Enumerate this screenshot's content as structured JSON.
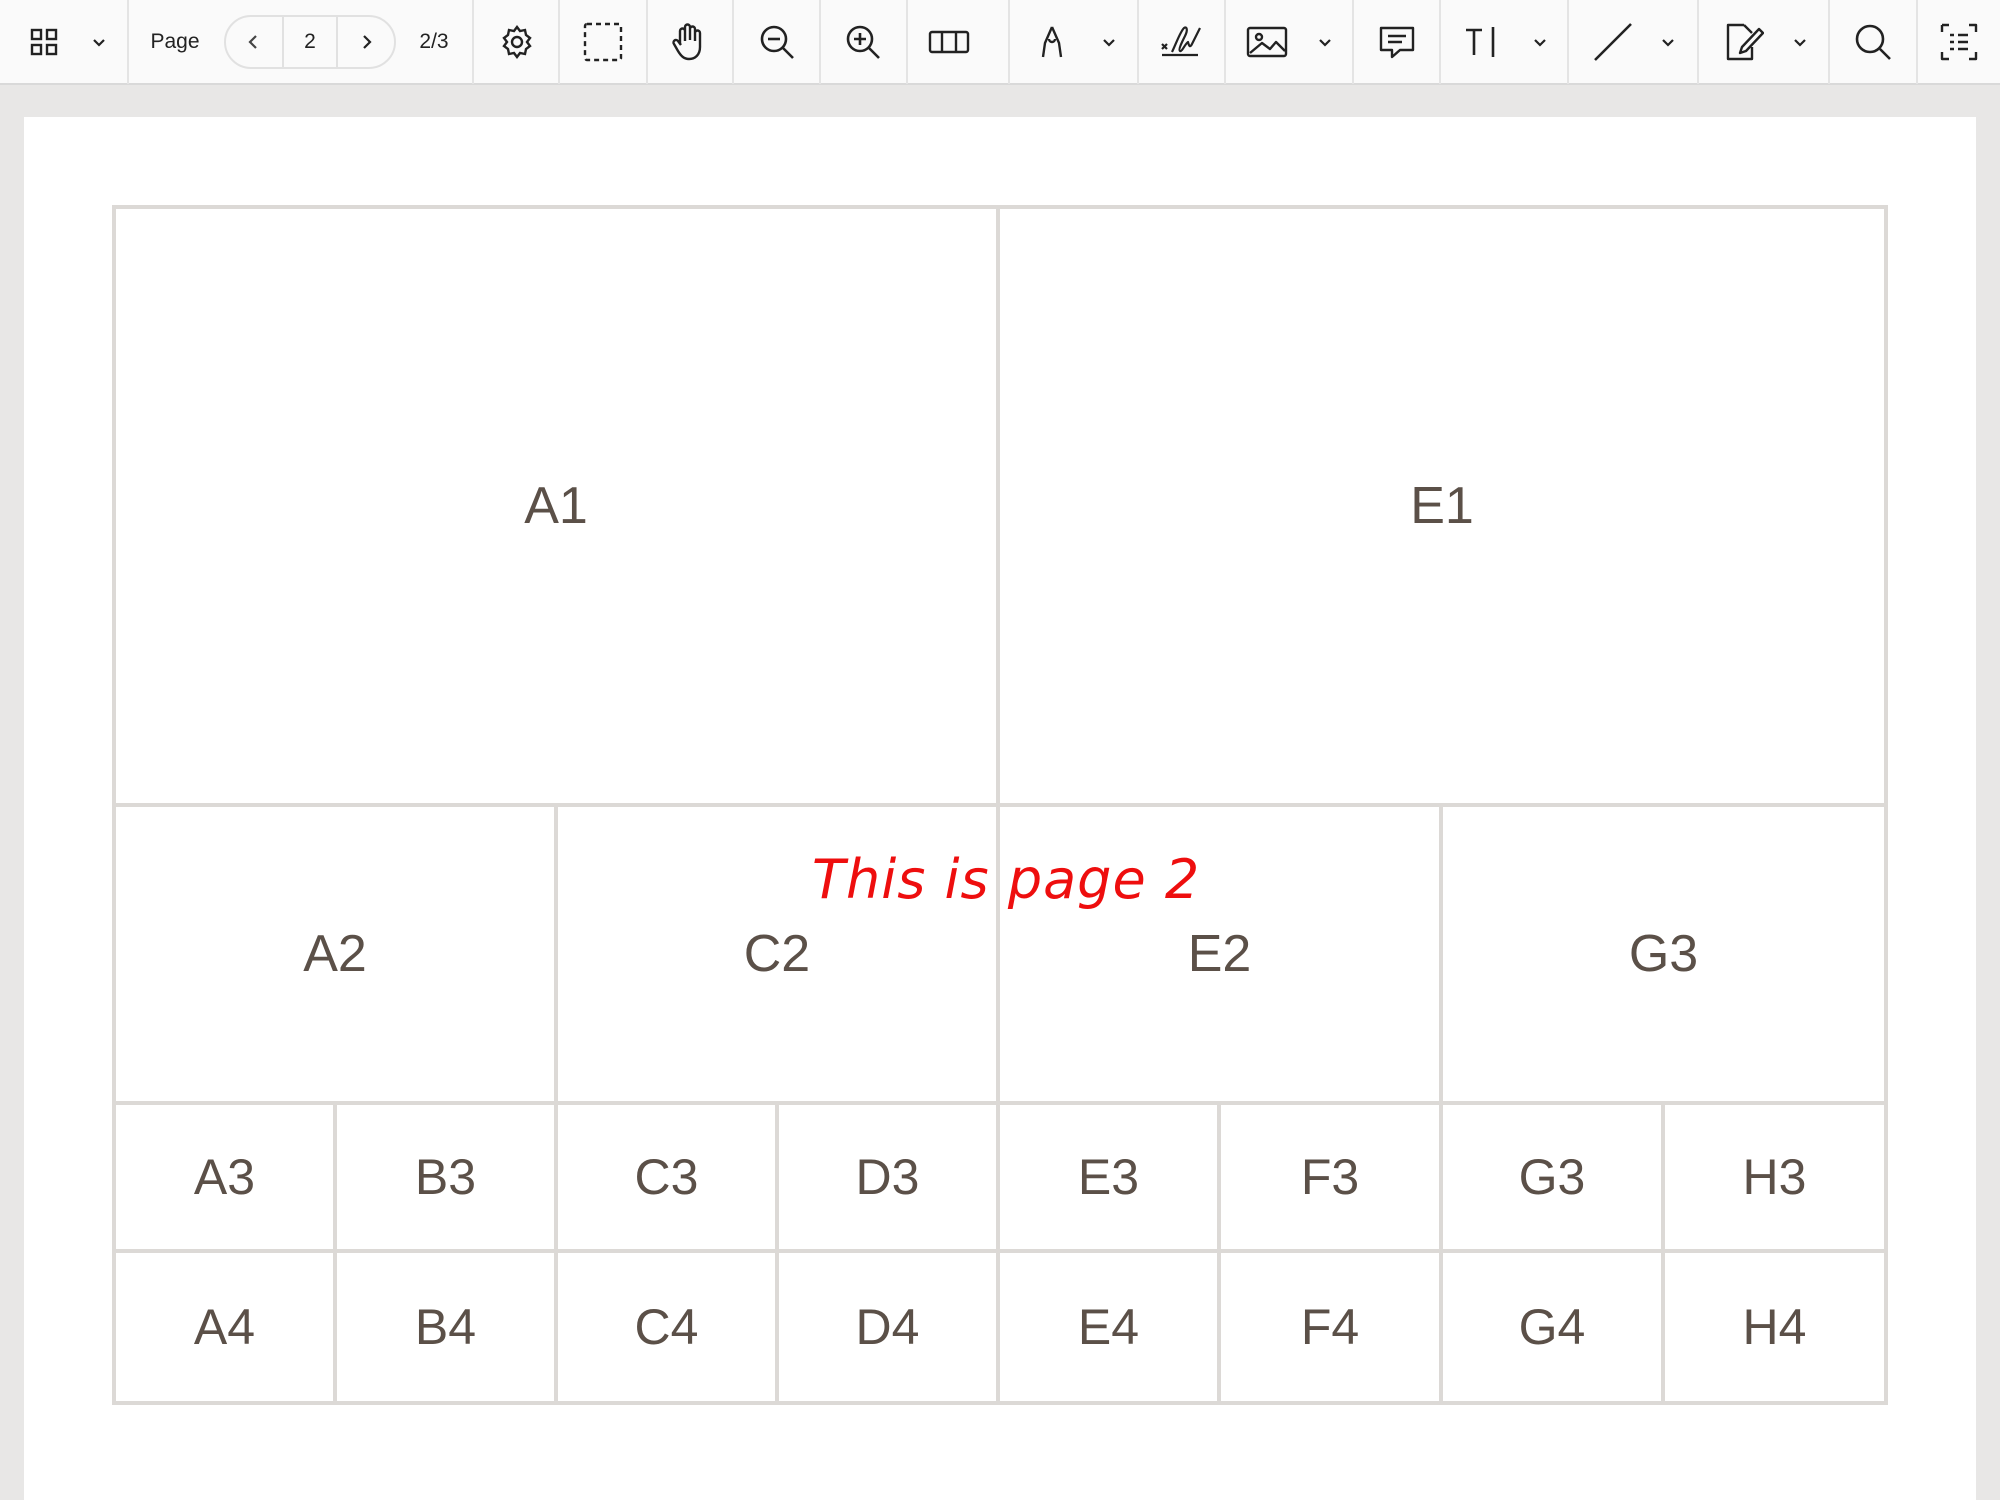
{
  "toolbar": {
    "page_label": "Page",
    "current_page": "2",
    "page_total": "2/3",
    "icons": [
      "grid-view-icon",
      "settings-icon",
      "marquee-select-icon",
      "hand-icon",
      "zoom-out-icon",
      "zoom-in-icon",
      "page-layout-icon",
      "pen-icon",
      "signature-icon",
      "image-icon",
      "comment-icon",
      "text-icon",
      "line-icon",
      "edit-icon",
      "search-icon",
      "form-icon"
    ]
  },
  "document": {
    "annotation": "This is page 2",
    "annotation_color": "#ee0e0e",
    "cells": {
      "a1": "A1",
      "e1": "E1",
      "a2": "A2",
      "c2": "C2",
      "e2": "E2",
      "g3_top": "G3",
      "a3": "A3",
      "b3": "B3",
      "c3": "C3",
      "d3": "D3",
      "e3": "E3",
      "f3": "F3",
      "g3": "G3",
      "h3": "H3",
      "a4": "A4",
      "b4": "B4",
      "c4": "C4",
      "d4": "D4",
      "e4": "E4",
      "f4": "F4",
      "g4": "G4",
      "h4": "H4"
    }
  }
}
